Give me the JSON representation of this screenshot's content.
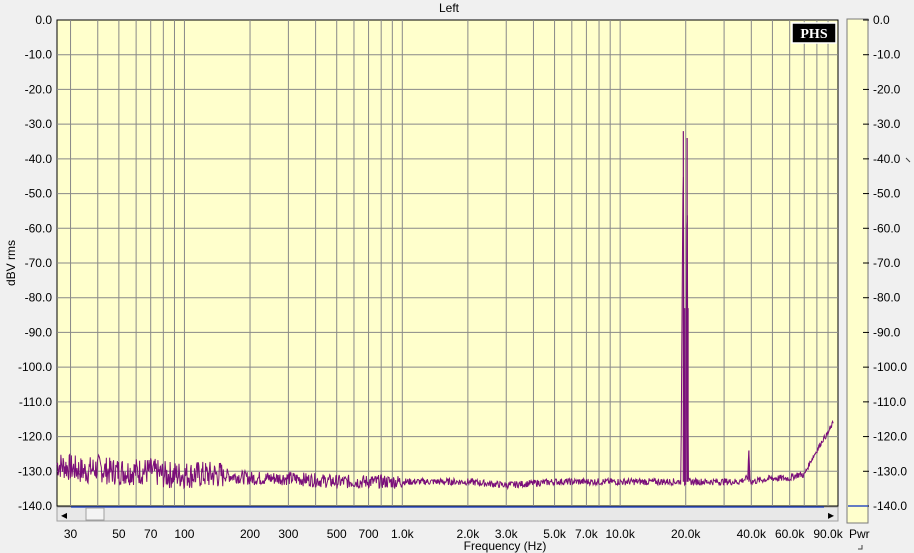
{
  "chart_data": {
    "type": "line",
    "title": "Left",
    "xlabel": "Frequency (Hz)",
    "ylabel": "dBV rms",
    "right_label": "Pwr",
    "logo": "PHS",
    "x_scale": "log",
    "xlim": [
      26,
      100000
    ],
    "ylim": [
      -140,
      0
    ],
    "grid": true,
    "y_ticks": [
      "0.0",
      "-10.0",
      "-20.0",
      "-30.0",
      "-40.0",
      "-50.0",
      "-60.0",
      "-70.0",
      "-80.0",
      "-90.0",
      "-100.0",
      "-110.0",
      "-120.0",
      "-130.0",
      "-140.0"
    ],
    "x_ticks": [
      {
        "value": 30,
        "label": "30"
      },
      {
        "value": 50,
        "label": "50"
      },
      {
        "value": 70,
        "label": "70"
      },
      {
        "value": 100,
        "label": "100"
      },
      {
        "value": 200,
        "label": "200"
      },
      {
        "value": 300,
        "label": "300"
      },
      {
        "value": 500,
        "label": "500"
      },
      {
        "value": 700,
        "label": "700"
      },
      {
        "value": 1000,
        "label": "1.0k"
      },
      {
        "value": 2000,
        "label": "2.0k"
      },
      {
        "value": 3000,
        "label": "3.0k"
      },
      {
        "value": 5000,
        "label": "5.0k"
      },
      {
        "value": 7000,
        "label": "7.0k"
      },
      {
        "value": 10000,
        "label": "10.0k"
      },
      {
        "value": 20000,
        "label": "20.0k"
      },
      {
        "value": 40000,
        "label": "40.0k"
      },
      {
        "value": 60000,
        "label": "60.0k"
      },
      {
        "value": 90000,
        "label": "90.0k"
      }
    ],
    "series": [
      {
        "color": "#7a0f7a",
        "points": [
          [
            26,
            -128
          ],
          [
            30,
            -129
          ],
          [
            35,
            -130
          ],
          [
            40,
            -129
          ],
          [
            45,
            -130
          ],
          [
            50,
            -130
          ],
          [
            60,
            -130
          ],
          [
            70,
            -130
          ],
          [
            80,
            -131
          ],
          [
            100,
            -131
          ],
          [
            150,
            -131
          ],
          [
            200,
            -132
          ],
          [
            300,
            -132
          ],
          [
            500,
            -133
          ],
          [
            700,
            -133
          ],
          [
            1000,
            -133
          ],
          [
            2000,
            -133
          ],
          [
            3000,
            -134
          ],
          [
            5000,
            -133
          ],
          [
            7000,
            -133
          ],
          [
            10000,
            -133
          ],
          [
            15000,
            -133
          ],
          [
            19000,
            -133
          ],
          [
            19500,
            -32
          ],
          [
            19700,
            -133
          ],
          [
            20000,
            -133
          ],
          [
            20300,
            -34
          ],
          [
            20500,
            -133
          ],
          [
            25000,
            -133
          ],
          [
            35000,
            -133
          ],
          [
            38500,
            -132
          ],
          [
            39000,
            -124
          ],
          [
            39500,
            -133
          ],
          [
            50000,
            -132
          ],
          [
            55000,
            -132
          ],
          [
            60000,
            -132
          ],
          [
            65000,
            -131
          ],
          [
            70000,
            -131
          ],
          [
            75000,
            -127
          ],
          [
            80000,
            -124
          ],
          [
            85000,
            -121
          ],
          [
            90000,
            -119
          ],
          [
            95000,
            -116
          ]
        ]
      }
    ],
    "scrollbar": {
      "left_arrow": "◂",
      "right_arrow": "▸"
    }
  }
}
